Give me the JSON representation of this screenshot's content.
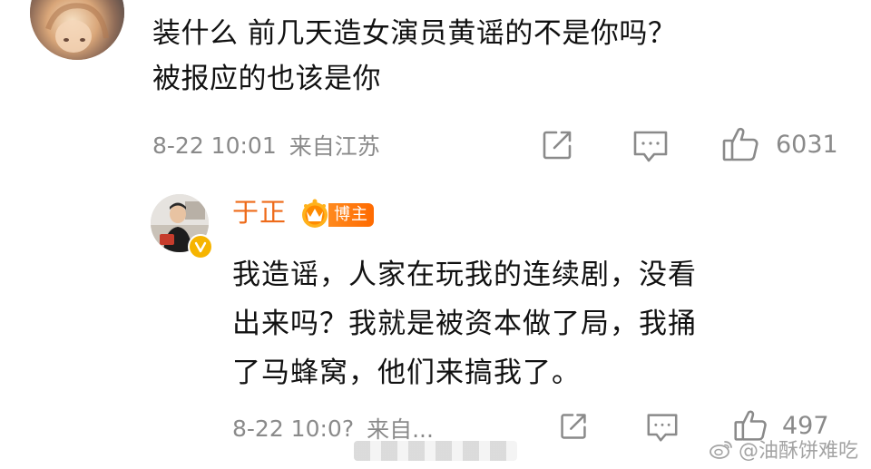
{
  "comment": {
    "text_lines": [
      "装什么 前几天造女演员黄谣的不是你吗？",
      "被报应的也该是你"
    ],
    "time": "8-22 10:01",
    "location": "来自江苏",
    "like_count": "6031",
    "icons": {
      "avatar": "user-avatar",
      "repost": "share-icon",
      "comment": "comment-icon",
      "like": "thumbs-up-icon"
    }
  },
  "reply": {
    "author": "于正",
    "badge_label": "博主",
    "text_lines": [
      "我造谣，人家在玩我的连续剧，没看",
      "出来吗？我就是被资本做了局，我捅",
      "了马蜂窝，他们来搞我了。"
    ],
    "time": "8-22 10:0?",
    "location": "来自...",
    "like_count": "497",
    "icons": {
      "avatar": "user-avatar",
      "verified": "verified-badge-icon",
      "crown": "crown-icon",
      "repost": "share-icon",
      "comment": "comment-icon",
      "like": "thumbs-up-icon"
    }
  },
  "watermark": {
    "text": "@油酥饼难吃",
    "icon": "weibo-logo-icon"
  },
  "colors": {
    "name_orange": "#ee6b1a",
    "badge_orange": "#ff7a10",
    "meta_gray": "#8a8a8a",
    "text_black": "#111111"
  }
}
